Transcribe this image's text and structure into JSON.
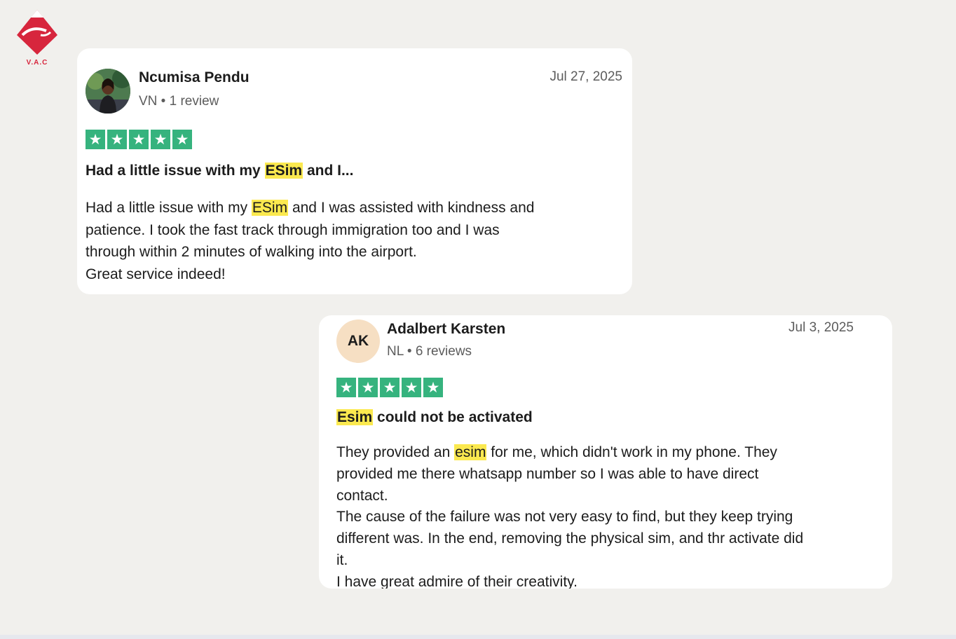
{
  "logo": {
    "text": "V.A.C"
  },
  "reviews": [
    {
      "name": "Ncumisa Pendu",
      "country": "VN",
      "review_count": "1 review",
      "date": "Jul 27, 2025",
      "rating": 5,
      "title_pre": "Had a little issue with my ",
      "title_hl": "ESim",
      "title_post": " and I...",
      "body_l1_pre": "Had a little issue with my ",
      "body_l1_hl": "ESim",
      "body_l1_post": " and I was assisted with kindness and",
      "body_l2": "patience. I took the fast track through immigration too and I was",
      "body_l3": "through within 2 minutes of walking into the airport.",
      "body_l4": "Great service indeed!"
    },
    {
      "initials": "AK",
      "name": "Adalbert Karsten",
      "country": "NL",
      "review_count": "6 reviews",
      "date": "Jul 3, 2025",
      "rating": 5,
      "title_hl": "Esim",
      "title_post": " could not be activated",
      "body_l1_pre": "They provided an ",
      "body_l1_hl": "esim",
      "body_l1_post": " for me, which didn't work in my phone. They",
      "body_l2": "provided me there whatsapp number so I was able to have direct",
      "body_l3": "contact.",
      "body_l4": "The cause of the failure was not very easy to find, but they keep trying",
      "body_l5": "different was. In the end, removing the physical sim, and thr activate did",
      "body_l6": "it.",
      "body_l7": "I have great admire of their creativity."
    }
  ],
  "colors": {
    "star_bg": "#36b37e",
    "highlight": "#fbe94f",
    "brand_red": "#d7263d"
  },
  "icons": {
    "star": "star-icon",
    "logo": "vac-logo"
  }
}
